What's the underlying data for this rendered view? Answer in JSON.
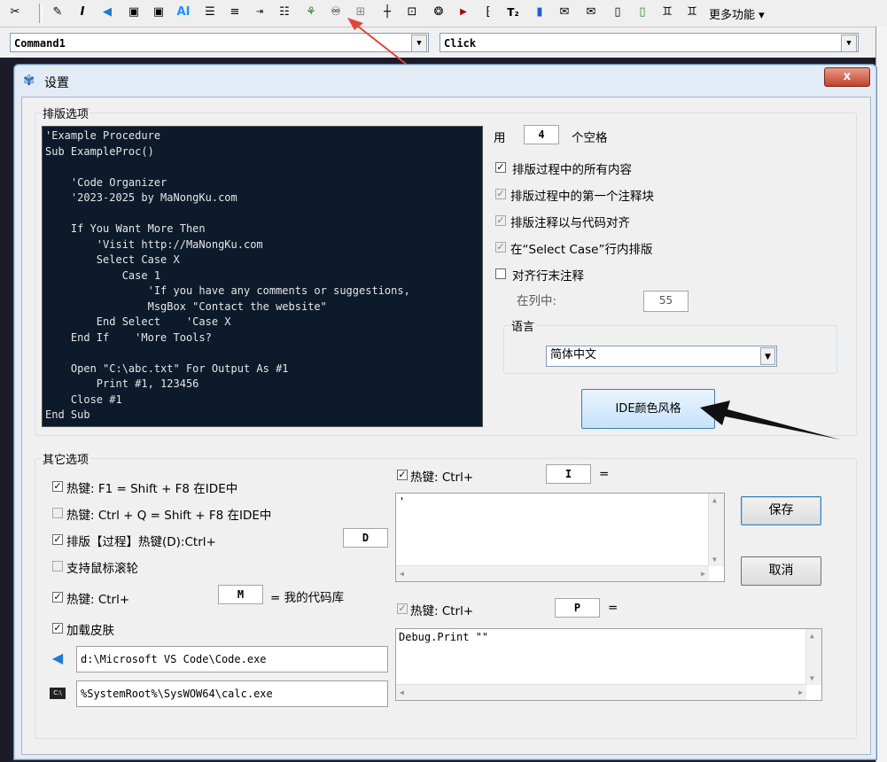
{
  "toolbar": {
    "more_label": "更多功能",
    "icons": [
      "wand-icon",
      "pencil-icon",
      "italic-icon",
      "vscode-icon",
      "save-icon",
      "save-all-icon",
      "ai-icon",
      "indent-icon",
      "align-icon",
      "wrap-icon",
      "outline-icon",
      "tree-icon",
      "fingerprint-icon",
      "grid-icon",
      "cross-grid-icon",
      "box-grid-icon",
      "brain-icon",
      "play-icon",
      "bracket-icon",
      "text-size-icon",
      "bookmark-icon",
      "comment-icon",
      "uncomment-icon",
      "page-icon",
      "add-page-icon",
      "binoculars-icon",
      "binoculars2-icon"
    ]
  },
  "combos": {
    "object": "Command1",
    "procedure": "Click"
  },
  "dialog": {
    "title": "设置",
    "close": "x"
  },
  "format_options": {
    "legend": "排版选项",
    "code_lines": [
      "'Example Procedure",
      "Sub ExampleProc()",
      "",
      "    'Code Organizer",
      "    '2023-2025 by MaNongKu.com",
      "",
      "    If You Want More Then",
      "        'Visit http://MaNongKu.com",
      "        Select Case X",
      "            Case 1",
      "                'If you have any comments or suggestions,",
      "                MsgBox \"Contact the website\"",
      "        End Select    'Case X",
      "    End If    'More Tools?",
      "",
      "    Open \"C:\\abc.txt\" For Output As #1",
      "        Print #1, 123456",
      "    Close #1",
      "End Sub"
    ],
    "use_label": "用",
    "spaces_value": "4",
    "spaces_label": "个空格",
    "opt_all": "排版过程中的所有内容",
    "opt_first_comment": "排版过程中的第一个注释块",
    "opt_align_comment": "排版注释以与代码对齐",
    "opt_select_case": "在“Select Case”行内排版",
    "opt_eol_comment": "对齐行末注释",
    "column_label": "在列中:",
    "column_value": "55",
    "language_legend": "语言",
    "language_value": "简体中文",
    "ide_color_button": "IDE颜色风格"
  },
  "other_options": {
    "legend": "其它选项",
    "hk1": "热键: F1 = Shift + F8 在IDE中",
    "hk2": "热键: Ctrl + Q = Shift + F8 在IDE中",
    "hk3": "排版【过程】热键(D):Ctrl+",
    "hk3_key": "D",
    "mouse_wheel": "支持鼠标滚轮",
    "hk4": "热键: Ctrl+",
    "hk4_key": "M",
    "hk4_suffix": "= 我的代码库",
    "skin": "加载皮肤",
    "vscode_path": "d:\\Microsoft VS Code\\Code.exe",
    "calc_path": "%SystemRoot%\\SysWOW64\\calc.exe",
    "hk5": "热键: Ctrl+",
    "hk5_key": "I",
    "hk5_eq": "=",
    "hk5_text": "'",
    "hk6": "热键: Ctrl+",
    "hk6_key": "P",
    "hk6_eq": "=",
    "hk6_text": "Debug.Print \"\"",
    "save_button": "保存",
    "cancel_button": "取消"
  },
  "colors": {
    "accent": "#2f6fb8",
    "code_bg": "#0d1a2b",
    "dialog_bg": "#e3ecf6",
    "annotation_arrow": "#e0443a"
  }
}
